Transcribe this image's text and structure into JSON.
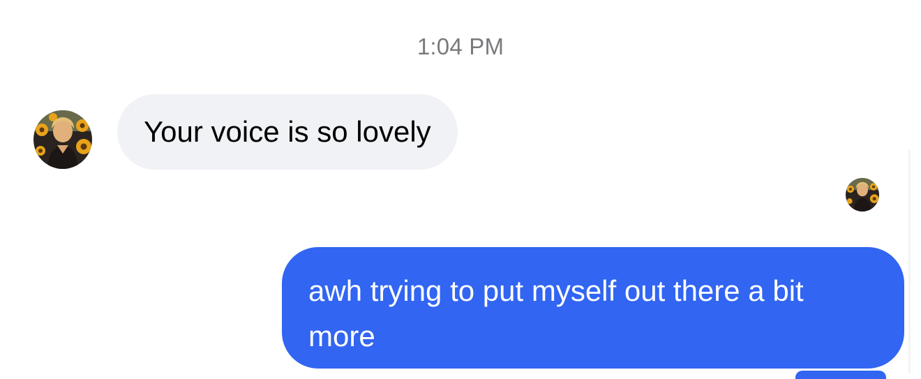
{
  "conversation": {
    "timestamp": "1:04 PM",
    "messages": [
      {
        "direction": "incoming",
        "text": "Your voice is so lovely"
      },
      {
        "direction": "outgoing",
        "text": "awh trying to put myself out there a bit more"
      }
    ]
  },
  "icons": {
    "sender_avatar": "contact-avatar",
    "read_receipt": "read-receipt-avatar"
  },
  "colors": {
    "incoming_bubble": "#f1f2f6",
    "outgoing_bubble": "#3165f2",
    "timestamp_text": "#7a7a7e",
    "outgoing_text": "#ffffff"
  }
}
